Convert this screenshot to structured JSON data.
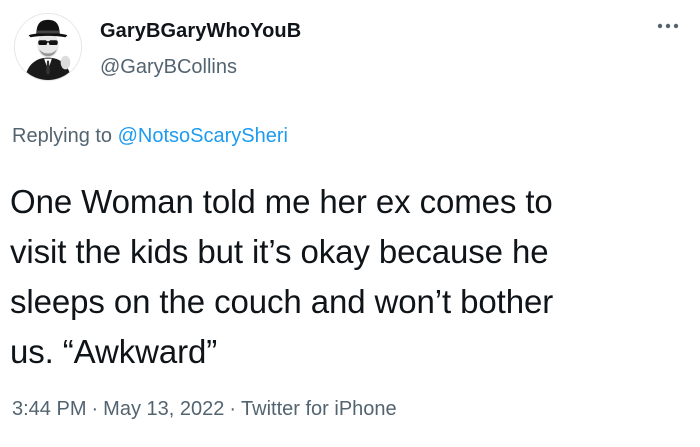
{
  "tweet": {
    "author": {
      "display_name": "GaryBGaryWhoYouB",
      "handle": "@GaryBCollins",
      "avatar_icon": "avatar-man-in-hat-and-sunglasses"
    },
    "more_icon": "more-dots-icon",
    "reply": {
      "prefix": "Replying to ",
      "mention": "@NotsoScarySheri"
    },
    "text_lines": [
      "One Woman told me her ex comes to",
      "visit the kids but it’s okay because he",
      "sleeps on the couch and won’t bother",
      "us. “Awkward”"
    ],
    "meta": {
      "time": "3:44 PM",
      "separator": "·",
      "date": "May 13, 2022",
      "source": "Twitter for iPhone"
    },
    "colors": {
      "text": "#0f1419",
      "secondary": "#536471",
      "link": "#1d9bf0"
    }
  }
}
